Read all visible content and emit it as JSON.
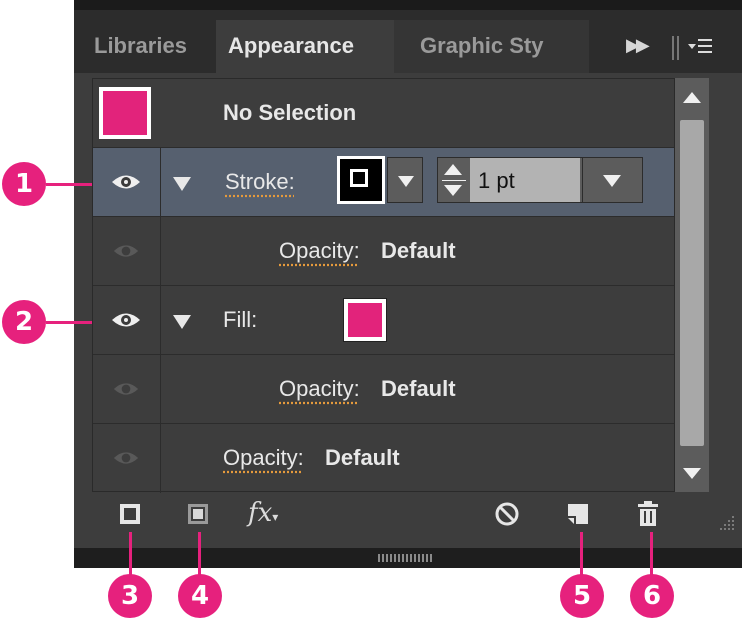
{
  "tabs": [
    {
      "label": "Libraries",
      "active": false
    },
    {
      "label": "Appearance",
      "active": true
    },
    {
      "label": "Graphic Sty",
      "active": false
    }
  ],
  "tab_icons": [
    "fast-forward-icon",
    "panel-menu-icon"
  ],
  "header": {
    "title": "No Selection"
  },
  "stroke_row": {
    "label": "Stroke:",
    "weight_value": "1 pt"
  },
  "fill_row": {
    "label": "Fill:"
  },
  "opacity_rows": [
    {
      "label": "Opacity:",
      "value": "Default"
    },
    {
      "label": "Opacity:",
      "value": "Default"
    },
    {
      "label": "Opacity:",
      "value": "Default"
    }
  ],
  "toolbar": {
    "fx_label": "fx"
  },
  "callouts": [
    "1",
    "2",
    "3",
    "4",
    "5",
    "6"
  ],
  "colors": {
    "fill": "#e2237b",
    "accent_orange": "#e59a3c",
    "callout": "#e6217d",
    "selected_row": "#56606f"
  }
}
